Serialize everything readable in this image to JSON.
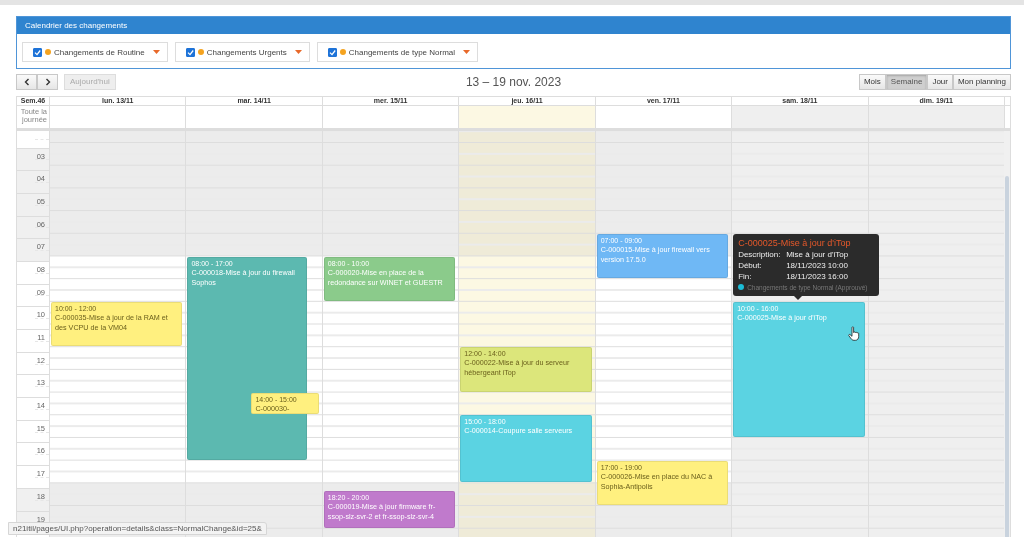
{
  "panel": {
    "title": "Calendrier des changements"
  },
  "filters": [
    {
      "label": "Changements de Routine",
      "checked": true,
      "color": "#f5a31f"
    },
    {
      "label": "Changements Urgents",
      "checked": true,
      "color": "#f5a31f"
    },
    {
      "label": "Changements de type Normal",
      "checked": true,
      "color": "#f5a31f"
    }
  ],
  "toolbar": {
    "today_button": {
      "label": "Aujourd'hui",
      "disabled": true
    },
    "range_title": "13 – 19 nov. 2023",
    "views": [
      {
        "label": "Mois",
        "selected": false
      },
      {
        "label": "Semaine",
        "selected": true
      },
      {
        "label": "Jour",
        "selected": false
      },
      {
        "label": "Mon planning",
        "selected": false
      }
    ]
  },
  "calendar": {
    "week_label": "Sem.46",
    "all_day_label": "Toute la journée",
    "hours": [
      {
        "label": "03",
        "working": false
      },
      {
        "label": "04",
        "working": false
      },
      {
        "label": "05",
        "working": false
      },
      {
        "label": "06",
        "working": false
      },
      {
        "label": "07",
        "working": false
      },
      {
        "label": "08",
        "working": true
      },
      {
        "label": "09",
        "working": true
      },
      {
        "label": "10",
        "working": true
      },
      {
        "label": "11",
        "working": true
      },
      {
        "label": "12",
        "working": true
      },
      {
        "label": "13",
        "working": true
      },
      {
        "label": "14",
        "working": true
      },
      {
        "label": "15",
        "working": true
      },
      {
        "label": "16",
        "working": true
      },
      {
        "label": "17",
        "working": true
      },
      {
        "label": "18",
        "working": false
      },
      {
        "label": "19",
        "working": false
      }
    ],
    "days": [
      {
        "label": "lun. 13/11",
        "kind": "weekday",
        "events": [
          {
            "time": "10:00 - 12:00",
            "title": "C-000035-Mise à jour de la RAM et des VCPU de la VM04",
            "color": "#fff07f",
            "hovered": false
          }
        ]
      },
      {
        "label": "mar. 14/11",
        "kind": "weekday",
        "events": [
          {
            "time": "08:00 - 17:00",
            "title": "C-000018-Mise à jour du firewall Sophos",
            "color": "#5cb9b0",
            "hovered": false
          },
          {
            "time": "14:00 - 15:00",
            "title": "C-000030-",
            "color": "#fff07f",
            "hovered": false
          }
        ]
      },
      {
        "label": "mer. 15/11",
        "kind": "weekday",
        "events": [
          {
            "time": "08:00 - 10:00",
            "title": "C-000020-Mise en place de la redondance sur WINET et GUESTR",
            "color": "#8bcb8b",
            "hovered": false
          },
          {
            "time": "18:20 - 20:00",
            "title": "C-000019-Mise à jour firmware fr-ssop-slz-svr-2 et fr-ssop-slz-svr-4",
            "color": "#c07acc",
            "hovered": false
          }
        ]
      },
      {
        "label": "jeu. 16/11",
        "kind": "today",
        "events": [
          {
            "time": "12:00 - 14:00",
            "title": "C-000022-Mise à jour du serveur hébergeant iTop",
            "color": "#dce67b",
            "hovered": false
          },
          {
            "time": "15:00 - 18:00",
            "title": "C-000014-Coupure salle serveurs",
            "color": "#5bd3e2",
            "hovered": false
          }
        ]
      },
      {
        "label": "ven. 17/11",
        "kind": "weekday",
        "events": [
          {
            "time": "07:00 - 09:00",
            "title": "C-000015-Mise à jour firewall vers version 17.5.0",
            "color": "#6fb8f5",
            "hovered": false
          },
          {
            "time": "17:00 - 19:00",
            "title": "C-000026-Mise en place du NAC à Sophia-Antipolis",
            "color": "#fff07f",
            "hovered": false
          }
        ]
      },
      {
        "label": "sam. 18/11",
        "kind": "weekend",
        "events": [
          {
            "time": "10:00 - 16:00",
            "title": "C-000025-Mise à jour d'iTop",
            "color": "#5bd3e2",
            "hovered": true
          }
        ]
      },
      {
        "label": "dim. 19/11",
        "kind": "weekend"
      }
    ]
  },
  "tooltip": {
    "title": "C-000025-Mise à jour d'iTop",
    "rows": [
      {
        "label": "Description:",
        "value": "Mise à jour d'iTop"
      },
      {
        "label": "Début:",
        "value": "18/11/2023 10:00"
      },
      {
        "label": "Fin:",
        "value": "18/11/2023 16:00"
      }
    ],
    "legend": {
      "label": "Changements de type Normal (Approuvé)",
      "color": "#1bbcd6"
    }
  },
  "status_bar": {
    "url": "n21itil/pages/UI.php?operation=details&class=NormalChange&id=25&"
  }
}
